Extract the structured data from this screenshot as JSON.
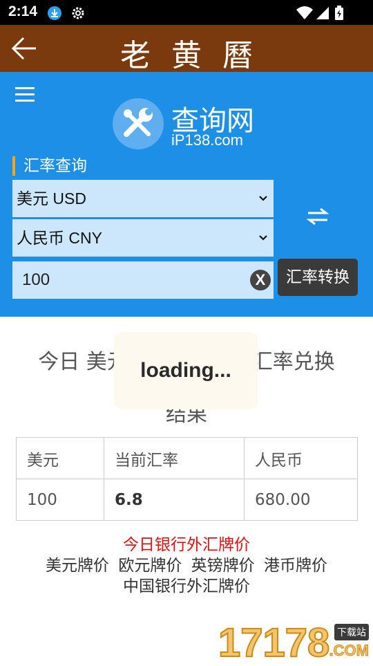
{
  "status_bar": {
    "time": "2:14",
    "icons": [
      "download-icon",
      "settings-icon",
      "wifi-icon",
      "cellular-icon",
      "battery-icon"
    ]
  },
  "title_bar": {
    "title": "老黄曆",
    "back_icon": "arrow-left-icon",
    "background": "#7a3a0d"
  },
  "tool": {
    "logo_cn": "查询网",
    "logo_en": "iP138.com",
    "section_label": "汇率查询",
    "from_currency": "美元 USD",
    "to_currency": "人民币 CNY",
    "amount": "100",
    "clear_label": "X",
    "convert_label": "汇率转换",
    "accent": "#1e8fe6"
  },
  "result": {
    "heading_line1_left": "今日 美元",
    "heading_line1_right": "汇率兑换",
    "heading_line2": "结果",
    "loading_text": "loading...",
    "table": {
      "headers": [
        "美元",
        "当前汇率",
        "人民币"
      ],
      "row": [
        "100",
        "6.8",
        "680.00"
      ]
    }
  },
  "links": {
    "red": "今日银行外汇牌价",
    "items": [
      "美元牌价",
      "欧元牌价",
      "英镑牌价",
      "港币牌价"
    ],
    "bottom": "中国银行外汇牌价"
  },
  "watermark": {
    "number": "17178",
    "badge": "下载站",
    "domain": ".COM"
  }
}
